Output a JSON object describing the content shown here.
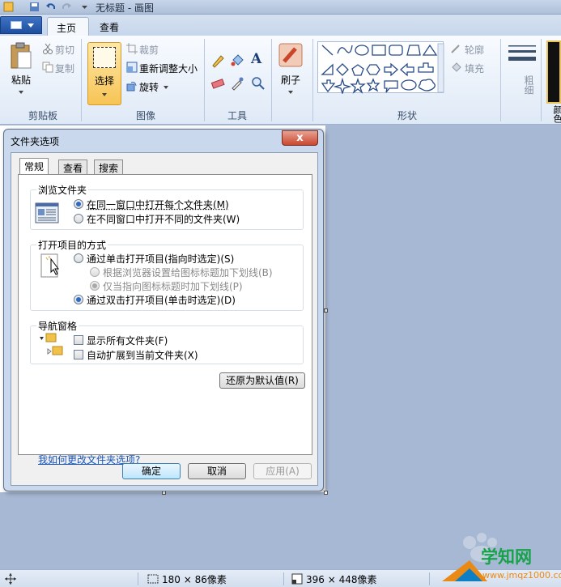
{
  "window": {
    "title": "无标题 - 画图"
  },
  "tabs": [
    {
      "label": "主页"
    },
    {
      "label": "查看"
    }
  ],
  "ribbon": {
    "clipboard": {
      "paste": "粘贴",
      "cut": "剪切",
      "copy": "复制",
      "group": "剪贴板"
    },
    "image": {
      "select": "选择",
      "crop": "裁剪",
      "resize": "重新调整大小",
      "rotate": "旋转",
      "group": "图像"
    },
    "tools": {
      "group": "工具",
      "text_tool": "A"
    },
    "brushes": {
      "label": "刷子"
    },
    "shapes": {
      "group": "形状",
      "outline": "轮廓",
      "fill": "填充"
    },
    "size": {
      "label": "粗细"
    },
    "colors": {
      "label": "颜色"
    }
  },
  "dialog": {
    "title": "文件夹选项",
    "close": "x",
    "tabs": [
      "常规",
      "查看",
      "搜索"
    ],
    "browse": {
      "legend": "浏览文件夹",
      "options": [
        {
          "label": "在同一窗口中打开每个文件夹(M)",
          "selected": true
        },
        {
          "label": "在不同窗口中打开不同的文件夹(W)",
          "selected": false
        }
      ]
    },
    "click": {
      "legend": "打开项目的方式",
      "single": "通过单击打开项目(指向时选定)(S)",
      "underline_browser": "根据浏览器设置给图标标题加下划线(B)",
      "underline_hover": "仅当指向图标标题时加下划线(P)",
      "double": "通过双击打开项目(单击时选定)(D)"
    },
    "nav": {
      "legend": "导航窗格",
      "show_all": "显示所有文件夹(F)",
      "auto_expand": "自动扩展到当前文件夹(X)"
    },
    "restore": "还原为默认值(R)",
    "help_link": "我如何更改文件夹选项?",
    "ok": "确定",
    "cancel": "取消",
    "apply": "应用(A)"
  },
  "status": {
    "selection_size": "180 × 86像素",
    "canvas_size": "396 × 448像素"
  },
  "watermark": {
    "logo": "学知网",
    "url": "www.jmqz1000.com"
  },
  "colors": {
    "accent": "#f7c455",
    "title_bg": "#c7d6ea",
    "canvas_bg": "#a7b8d4"
  }
}
